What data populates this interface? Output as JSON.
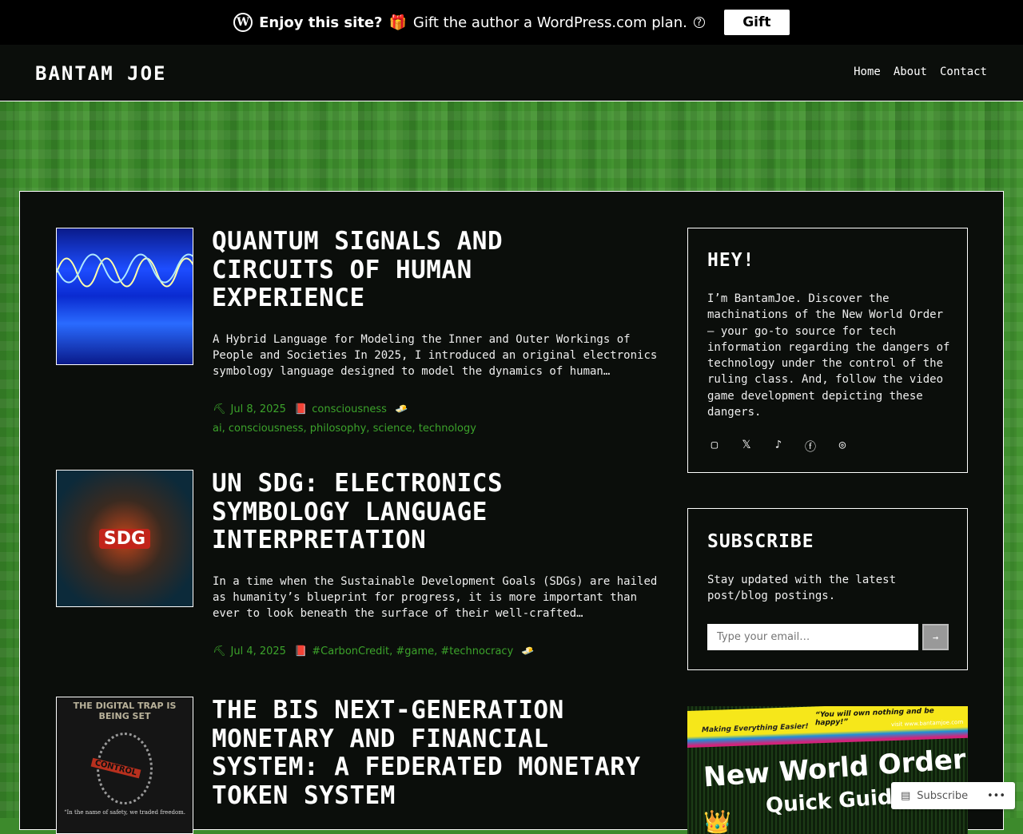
{
  "banner": {
    "enjoy": "Enjoy this site?",
    "gift_emoji": "🎁",
    "message": "Gift the author a WordPress.com plan.",
    "help": "?",
    "gift_button": "Gift",
    "wp_logo": "W"
  },
  "header": {
    "site_title": "BANTAM JOE",
    "nav": [
      "Home",
      "About",
      "Contact"
    ]
  },
  "posts": [
    {
      "title": "Quantum Signals and Circuits of Human Experience",
      "excerpt": "A Hybrid Language for Modeling the Inner and Outer Workings of People and Societies In 2025, I introduced an original electronics symbology language designed to model the dynamics of human…",
      "date": "Jul 8, 2025",
      "category": "consciousness",
      "tags": "ai, consciousness, philosophy, science, technology"
    },
    {
      "title": "UN SDG: Electronics Symbology Language Interpretation",
      "excerpt": "In a time when the Sustainable Development Goals (SDGs) are hailed as humanity’s blueprint for progress, it is more important than ever to look beneath the surface of their well-crafted…",
      "date": "Jul 4, 2025",
      "category": "#CarbonCredit, #game, #technocracy",
      "thumb_text": "SDG"
    },
    {
      "title": "The BIS Next-Generation Monetary and Financial System: A Federated Monetary Token System",
      "thumb_title": "THE DIGITAL TRAP IS BEING SET",
      "thumb_tape": "CONTROL",
      "thumb_quote": "“In the name of safety, we traded freedom."
    }
  ],
  "sidebar": {
    "hey": {
      "title": "HEY!",
      "text": "I’m BantamJoe. Discover the machinations of the New World Order – your go-to source for tech information regarding the dangers of technology under the control of the ruling class. And, follow the video game development depicting these dangers."
    },
    "subscribe": {
      "title": "SUBSCRIBE",
      "text": "Stay updated with the latest post/blog postings.",
      "placeholder": "Type your email…",
      "submit": "→"
    },
    "promo": {
      "tagline": "Making Everything Easier!",
      "quote": "“You will own nothing and be happy!”",
      "url": "visit www.bantamjoe.com",
      "title": "New World Order",
      "subtitle": "Quick Guide"
    }
  },
  "floating": {
    "subscribe": "Subscribe",
    "more": "•••"
  }
}
